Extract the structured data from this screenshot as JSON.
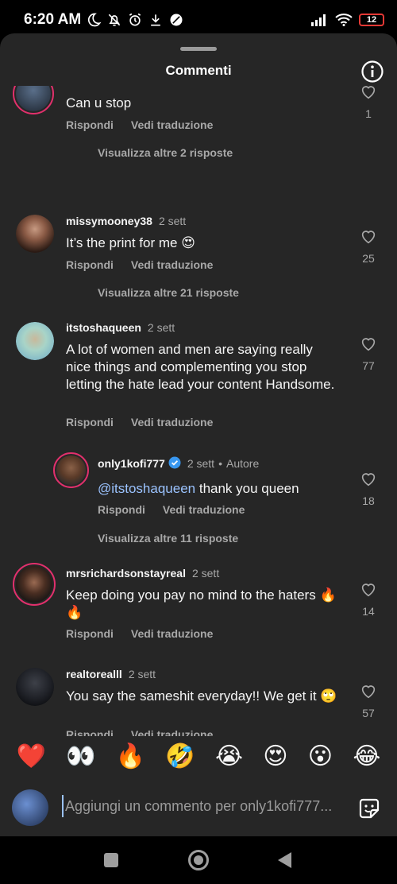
{
  "status_bar": {
    "time": "6:20 AM",
    "battery": "12"
  },
  "sheet": {
    "title": "Commenti"
  },
  "labels": {
    "reply": "Rispondi",
    "translate": "Vedi traduzione"
  },
  "comments": [
    {
      "text": "Can u stop",
      "likes": "1",
      "more": "Visualizza altre 2 risposte"
    },
    {
      "user": "missymooney38",
      "time": "2 sett",
      "text": "It’s the print for me 😍",
      "likes": "25",
      "more": "Visualizza altre 21 risposte"
    },
    {
      "user": "itstoshaqueen",
      "time": "2 sett",
      "text": "A lot of women and men are saying really nice things and complementing you stop letting the hate lead your content Handsome.",
      "likes": "77"
    },
    {
      "user": "only1kofi777",
      "time": "2 sett",
      "author_tag": "Autore",
      "mention": "@itstoshaqueen",
      "text": " thank you queen",
      "likes": "18",
      "more": "Visualizza altre 11 risposte"
    },
    {
      "user": "mrsrichardsonstayreal",
      "time": "2 sett",
      "text": "Keep doing you pay no mind to the haters 🔥🔥",
      "likes": "14"
    },
    {
      "user": "realtorealll",
      "time": "2 sett",
      "text": "You say the sameshit everyday!! We get it 🙄",
      "likes": "57"
    }
  ],
  "emoji_bar": [
    "❤️",
    "👀",
    "🔥",
    "🤣",
    "😭",
    "😍",
    "😮",
    "😂"
  ],
  "compose": {
    "placeholder": "Aggiungi un commento per only1kofi777..."
  },
  "icons": {
    "info": "info-icon",
    "heart": "heart-outline-icon",
    "verified": "verified-badge-icon",
    "sticker": "sticker-icon"
  },
  "colors": {
    "sheet_bg": "#262626",
    "mention": "#9bc3ff",
    "story_ring": "#e1306c",
    "verified": "#3897f0"
  }
}
